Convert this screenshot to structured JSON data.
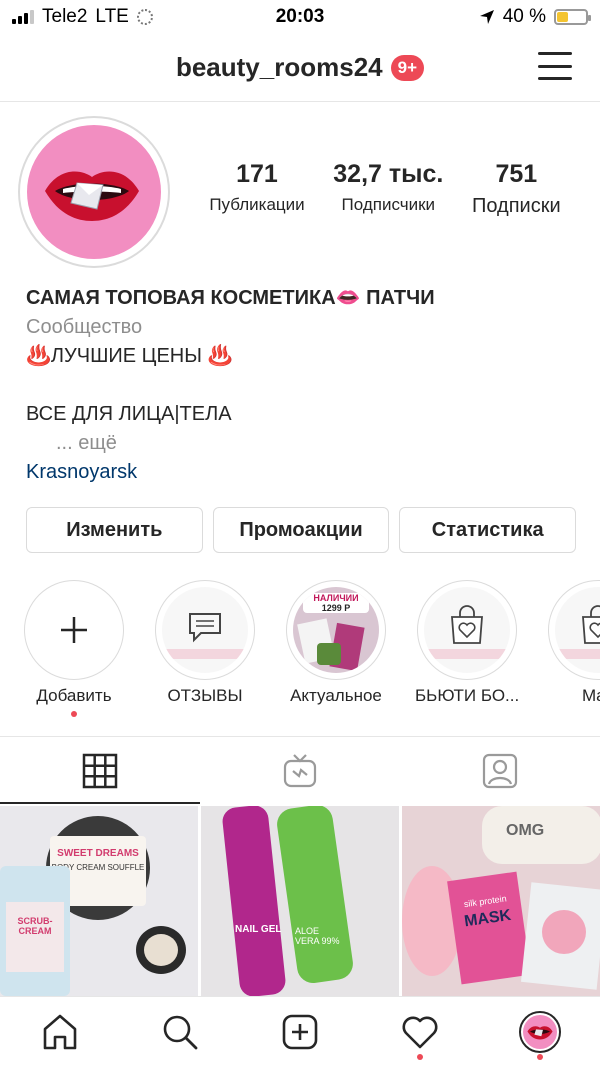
{
  "status_bar": {
    "carrier": "Tele2",
    "network": "LTE",
    "time": "20:03",
    "battery_percent": "40 %",
    "battery_level": 0.4
  },
  "header": {
    "username": "beauty_rooms24",
    "notification_badge": "9+"
  },
  "profile": {
    "stats": [
      {
        "value": "171",
        "label": "Публикации"
      },
      {
        "value": "32,7 тыс.",
        "label": "Подписчики"
      },
      {
        "value": "751",
        "label": "Подписки"
      }
    ],
    "name": "САМАЯ ТОПОВАЯ КОСМЕТИКА👄 ПАТЧИ",
    "category": "Сообщество",
    "bio_line1": "♨️ЛУЧШИЕ ЦЕНЫ ♨️",
    "bio_line2": "ВСЕ ДЛЯ ЛИЦА|ТЕЛА",
    "more": "... ещё",
    "location": "Krasnoyarsk"
  },
  "actions": {
    "edit": "Изменить",
    "promotions": "Промоакции",
    "insights": "Статистика"
  },
  "highlights": [
    {
      "label": "Добавить",
      "icon": "plus-icon"
    },
    {
      "label": "ОТЗЫВЫ",
      "icon": "chat-bubble-icon"
    },
    {
      "label": "Актуальное",
      "icon": "photo-thumbnail",
      "price_tag": "НАЛИЧИИ",
      "price": "1299 Р"
    },
    {
      "label": "БЬЮТИ БО...",
      "icon": "shopping-bag-heart-icon"
    },
    {
      "label": "Mac",
      "icon": "shopping-bag-heart-icon"
    }
  ],
  "tabs": [
    {
      "name": "grid",
      "icon": "grid-icon",
      "active": true
    },
    {
      "name": "igtv",
      "icon": "igtv-icon",
      "active": false
    },
    {
      "name": "tagged",
      "icon": "tagged-person-icon",
      "active": false
    }
  ],
  "posts": [
    {
      "caption_top": "SWEET DREAMS",
      "caption_mid": "BODY CREAM SOUFFLE",
      "caption_side": "SCRUB-CREAM"
    },
    {
      "caption_top": "NAIL GEL",
      "caption_mid": "ALOE VERA 99%"
    },
    {
      "caption_top": "OMG",
      "caption_mid": "MASK",
      "caption_side": "silk protein"
    }
  ],
  "bottom_nav": [
    {
      "icon": "home-icon"
    },
    {
      "icon": "search-icon"
    },
    {
      "icon": "new-post-icon"
    },
    {
      "icon": "heart-icon"
    },
    {
      "icon": "profile-avatar"
    }
  ]
}
